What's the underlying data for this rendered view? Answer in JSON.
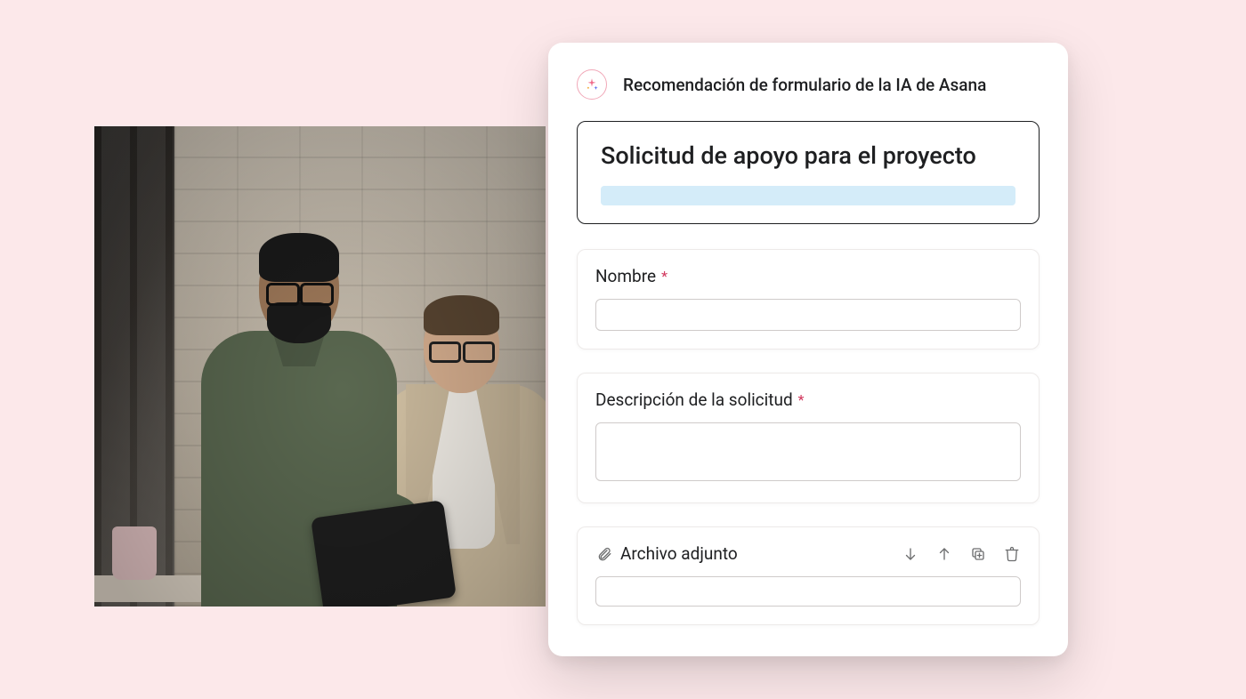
{
  "header": {
    "title": "Recomendación de formulario de la IA de Asana"
  },
  "form": {
    "title": "Solicitud de apoyo para el proyecto",
    "fields": {
      "name": {
        "label": "Nombre",
        "required": true,
        "value": ""
      },
      "description": {
        "label": "Descripción de la solicitud",
        "required": true,
        "value": ""
      },
      "attachment": {
        "label": "Archivo adjunto",
        "value": ""
      }
    }
  },
  "icons": {
    "ai": "ai-sparkle-icon",
    "paperclip": "paperclip-icon",
    "arrow_down": "arrow-down-icon",
    "arrow_up": "arrow-up-icon",
    "duplicate": "duplicate-icon",
    "trash": "trash-icon"
  }
}
